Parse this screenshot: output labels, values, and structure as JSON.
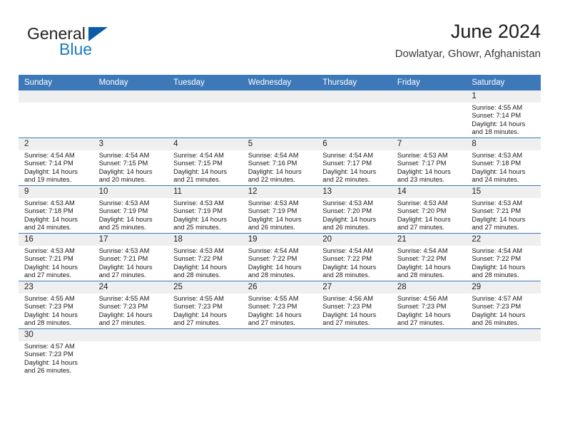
{
  "brand": {
    "name_top": "General",
    "name_bottom": "Blue",
    "triangle_color": "#0b5ca5",
    "blue_text_color": "#1a7cc2"
  },
  "header": {
    "title": "June 2024",
    "subtitle": "Dowlatyar, Ghowr, Afghanistan"
  },
  "theme": {
    "header_blue": "#3d79b9",
    "daynum_band": "#efefef",
    "row_divider": "#3d79b9"
  },
  "weekday_headers": [
    "Sunday",
    "Monday",
    "Tuesday",
    "Wednesday",
    "Thursday",
    "Friday",
    "Saturday"
  ],
  "labels": {
    "sunrise_prefix": "Sunrise:",
    "sunset_prefix": "Sunset:",
    "daylight_prefix": "Daylight:"
  },
  "weeks": [
    [
      {
        "day": "",
        "sunrise": "",
        "sunset": "",
        "daylight_line1": "",
        "daylight_line2": ""
      },
      {
        "day": "",
        "sunrise": "",
        "sunset": "",
        "daylight_line1": "",
        "daylight_line2": ""
      },
      {
        "day": "",
        "sunrise": "",
        "sunset": "",
        "daylight_line1": "",
        "daylight_line2": ""
      },
      {
        "day": "",
        "sunrise": "",
        "sunset": "",
        "daylight_line1": "",
        "daylight_line2": ""
      },
      {
        "day": "",
        "sunrise": "",
        "sunset": "",
        "daylight_line1": "",
        "daylight_line2": ""
      },
      {
        "day": "",
        "sunrise": "",
        "sunset": "",
        "daylight_line1": "",
        "daylight_line2": ""
      },
      {
        "day": "1",
        "sunrise": "Sunrise: 4:55 AM",
        "sunset": "Sunset: 7:14 PM",
        "daylight_line1": "Daylight: 14 hours",
        "daylight_line2": "and 18 minutes."
      }
    ],
    [
      {
        "day": "2",
        "sunrise": "Sunrise: 4:54 AM",
        "sunset": "Sunset: 7:14 PM",
        "daylight_line1": "Daylight: 14 hours",
        "daylight_line2": "and 19 minutes."
      },
      {
        "day": "3",
        "sunrise": "Sunrise: 4:54 AM",
        "sunset": "Sunset: 7:15 PM",
        "daylight_line1": "Daylight: 14 hours",
        "daylight_line2": "and 20 minutes."
      },
      {
        "day": "4",
        "sunrise": "Sunrise: 4:54 AM",
        "sunset": "Sunset: 7:15 PM",
        "daylight_line1": "Daylight: 14 hours",
        "daylight_line2": "and 21 minutes."
      },
      {
        "day": "5",
        "sunrise": "Sunrise: 4:54 AM",
        "sunset": "Sunset: 7:16 PM",
        "daylight_line1": "Daylight: 14 hours",
        "daylight_line2": "and 22 minutes."
      },
      {
        "day": "6",
        "sunrise": "Sunrise: 4:54 AM",
        "sunset": "Sunset: 7:17 PM",
        "daylight_line1": "Daylight: 14 hours",
        "daylight_line2": "and 22 minutes."
      },
      {
        "day": "7",
        "sunrise": "Sunrise: 4:53 AM",
        "sunset": "Sunset: 7:17 PM",
        "daylight_line1": "Daylight: 14 hours",
        "daylight_line2": "and 23 minutes."
      },
      {
        "day": "8",
        "sunrise": "Sunrise: 4:53 AM",
        "sunset": "Sunset: 7:18 PM",
        "daylight_line1": "Daylight: 14 hours",
        "daylight_line2": "and 24 minutes."
      }
    ],
    [
      {
        "day": "9",
        "sunrise": "Sunrise: 4:53 AM",
        "sunset": "Sunset: 7:18 PM",
        "daylight_line1": "Daylight: 14 hours",
        "daylight_line2": "and 24 minutes."
      },
      {
        "day": "10",
        "sunrise": "Sunrise: 4:53 AM",
        "sunset": "Sunset: 7:19 PM",
        "daylight_line1": "Daylight: 14 hours",
        "daylight_line2": "and 25 minutes."
      },
      {
        "day": "11",
        "sunrise": "Sunrise: 4:53 AM",
        "sunset": "Sunset: 7:19 PM",
        "daylight_line1": "Daylight: 14 hours",
        "daylight_line2": "and 25 minutes."
      },
      {
        "day": "12",
        "sunrise": "Sunrise: 4:53 AM",
        "sunset": "Sunset: 7:19 PM",
        "daylight_line1": "Daylight: 14 hours",
        "daylight_line2": "and 26 minutes."
      },
      {
        "day": "13",
        "sunrise": "Sunrise: 4:53 AM",
        "sunset": "Sunset: 7:20 PM",
        "daylight_line1": "Daylight: 14 hours",
        "daylight_line2": "and 26 minutes."
      },
      {
        "day": "14",
        "sunrise": "Sunrise: 4:53 AM",
        "sunset": "Sunset: 7:20 PM",
        "daylight_line1": "Daylight: 14 hours",
        "daylight_line2": "and 27 minutes."
      },
      {
        "day": "15",
        "sunrise": "Sunrise: 4:53 AM",
        "sunset": "Sunset: 7:21 PM",
        "daylight_line1": "Daylight: 14 hours",
        "daylight_line2": "and 27 minutes."
      }
    ],
    [
      {
        "day": "16",
        "sunrise": "Sunrise: 4:53 AM",
        "sunset": "Sunset: 7:21 PM",
        "daylight_line1": "Daylight: 14 hours",
        "daylight_line2": "and 27 minutes."
      },
      {
        "day": "17",
        "sunrise": "Sunrise: 4:53 AM",
        "sunset": "Sunset: 7:21 PM",
        "daylight_line1": "Daylight: 14 hours",
        "daylight_line2": "and 27 minutes."
      },
      {
        "day": "18",
        "sunrise": "Sunrise: 4:53 AM",
        "sunset": "Sunset: 7:22 PM",
        "daylight_line1": "Daylight: 14 hours",
        "daylight_line2": "and 28 minutes."
      },
      {
        "day": "19",
        "sunrise": "Sunrise: 4:54 AM",
        "sunset": "Sunset: 7:22 PM",
        "daylight_line1": "Daylight: 14 hours",
        "daylight_line2": "and 28 minutes."
      },
      {
        "day": "20",
        "sunrise": "Sunrise: 4:54 AM",
        "sunset": "Sunset: 7:22 PM",
        "daylight_line1": "Daylight: 14 hours",
        "daylight_line2": "and 28 minutes."
      },
      {
        "day": "21",
        "sunrise": "Sunrise: 4:54 AM",
        "sunset": "Sunset: 7:22 PM",
        "daylight_line1": "Daylight: 14 hours",
        "daylight_line2": "and 28 minutes."
      },
      {
        "day": "22",
        "sunrise": "Sunrise: 4:54 AM",
        "sunset": "Sunset: 7:22 PM",
        "daylight_line1": "Daylight: 14 hours",
        "daylight_line2": "and 28 minutes."
      }
    ],
    [
      {
        "day": "23",
        "sunrise": "Sunrise: 4:55 AM",
        "sunset": "Sunset: 7:23 PM",
        "daylight_line1": "Daylight: 14 hours",
        "daylight_line2": "and 28 minutes."
      },
      {
        "day": "24",
        "sunrise": "Sunrise: 4:55 AM",
        "sunset": "Sunset: 7:23 PM",
        "daylight_line1": "Daylight: 14 hours",
        "daylight_line2": "and 27 minutes."
      },
      {
        "day": "25",
        "sunrise": "Sunrise: 4:55 AM",
        "sunset": "Sunset: 7:23 PM",
        "daylight_line1": "Daylight: 14 hours",
        "daylight_line2": "and 27 minutes."
      },
      {
        "day": "26",
        "sunrise": "Sunrise: 4:55 AM",
        "sunset": "Sunset: 7:23 PM",
        "daylight_line1": "Daylight: 14 hours",
        "daylight_line2": "and 27 minutes."
      },
      {
        "day": "27",
        "sunrise": "Sunrise: 4:56 AM",
        "sunset": "Sunset: 7:23 PM",
        "daylight_line1": "Daylight: 14 hours",
        "daylight_line2": "and 27 minutes."
      },
      {
        "day": "28",
        "sunrise": "Sunrise: 4:56 AM",
        "sunset": "Sunset: 7:23 PM",
        "daylight_line1": "Daylight: 14 hours",
        "daylight_line2": "and 27 minutes."
      },
      {
        "day": "29",
        "sunrise": "Sunrise: 4:57 AM",
        "sunset": "Sunset: 7:23 PM",
        "daylight_line1": "Daylight: 14 hours",
        "daylight_line2": "and 26 minutes."
      }
    ],
    [
      {
        "day": "30",
        "sunrise": "Sunrise: 4:57 AM",
        "sunset": "Sunset: 7:23 PM",
        "daylight_line1": "Daylight: 14 hours",
        "daylight_line2": "and 26 minutes."
      },
      {
        "day": "",
        "sunrise": "",
        "sunset": "",
        "daylight_line1": "",
        "daylight_line2": ""
      },
      {
        "day": "",
        "sunrise": "",
        "sunset": "",
        "daylight_line1": "",
        "daylight_line2": ""
      },
      {
        "day": "",
        "sunrise": "",
        "sunset": "",
        "daylight_line1": "",
        "daylight_line2": ""
      },
      {
        "day": "",
        "sunrise": "",
        "sunset": "",
        "daylight_line1": "",
        "daylight_line2": ""
      },
      {
        "day": "",
        "sunrise": "",
        "sunset": "",
        "daylight_line1": "",
        "daylight_line2": ""
      },
      {
        "day": "",
        "sunrise": "",
        "sunset": "",
        "daylight_line1": "",
        "daylight_line2": ""
      }
    ]
  ]
}
